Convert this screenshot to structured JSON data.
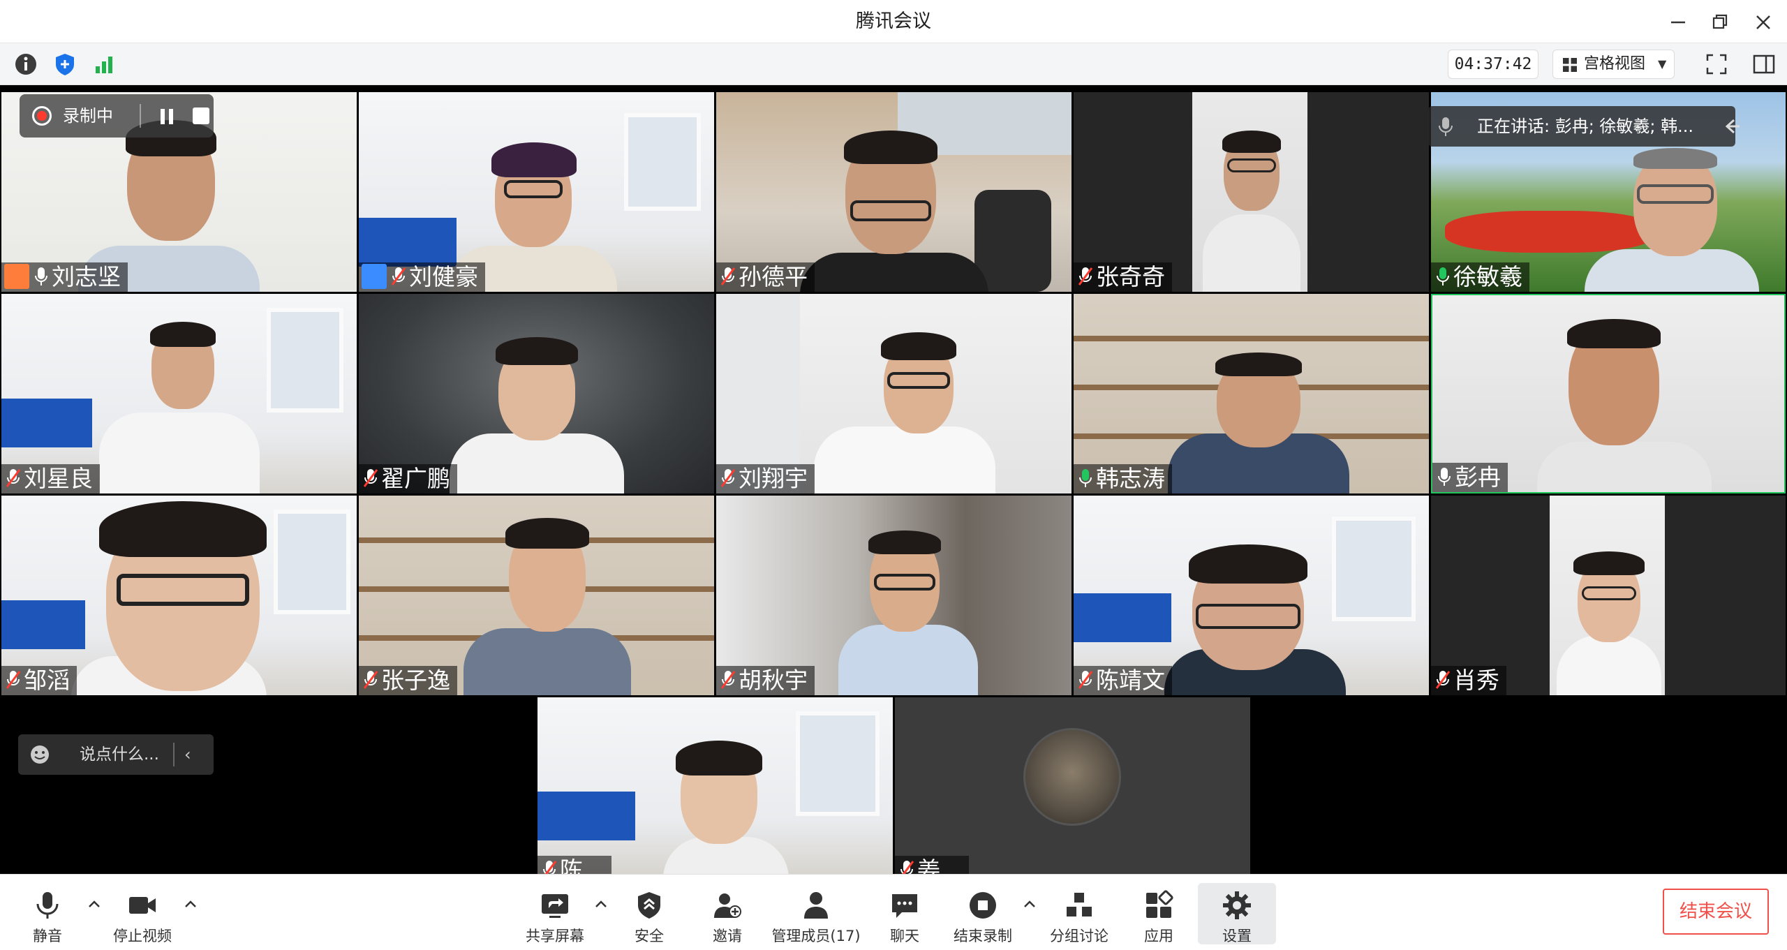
{
  "window": {
    "title": "腾讯会议"
  },
  "infobar": {
    "timer": "04:37:42",
    "view_mode": "宫格视图"
  },
  "recording": {
    "label": "录制中"
  },
  "speaking": {
    "text": "正在讲话: 彭冉; 徐敏羲; 韩..."
  },
  "chat": {
    "placeholder": "说点什么..."
  },
  "participants": [
    {
      "name": "刘志坚",
      "role": "host",
      "mic": "on"
    },
    {
      "name": "刘健豪",
      "role": "cohost",
      "mic": "muted"
    },
    {
      "name": "孙德平",
      "mic": "muted"
    },
    {
      "name": "张奇奇",
      "mic": "muted"
    },
    {
      "name": "徐敏羲",
      "mic": "speaking"
    },
    {
      "name": "刘星良",
      "mic": "muted"
    },
    {
      "name": "翟广鹏",
      "mic": "muted"
    },
    {
      "name": "刘翔宇",
      "mic": "muted"
    },
    {
      "name": "韩志涛",
      "mic": "speaking"
    },
    {
      "name": "彭冉",
      "mic": "on"
    },
    {
      "name": "邹滔",
      "mic": "muted"
    },
    {
      "name": "张子逸",
      "mic": "muted"
    },
    {
      "name": "胡秋宇",
      "mic": "muted"
    },
    {
      "name": "陈靖文",
      "mic": "muted"
    },
    {
      "name": "肖秀",
      "mic": "muted"
    },
    {
      "name": "陈... ",
      "mic": "muted"
    },
    {
      "name": "姜... ",
      "mic": "muted"
    }
  ],
  "toolbar": {
    "mute": "静音",
    "stop_video": "停止视频",
    "share_screen": "共享屏幕",
    "security": "安全",
    "invite": "邀请",
    "manage_members": "管理成员(17)",
    "chat": "聊天",
    "end_recording": "结束录制",
    "breakout": "分组讨论",
    "apps": "应用",
    "settings": "设置",
    "end_meeting": "结束会议"
  },
  "colors": {
    "accent_blue": "#1a73e8",
    "end_red": "#f0504a",
    "speaking_green": "#22c55e",
    "host_orange": "#ff7d3a"
  }
}
